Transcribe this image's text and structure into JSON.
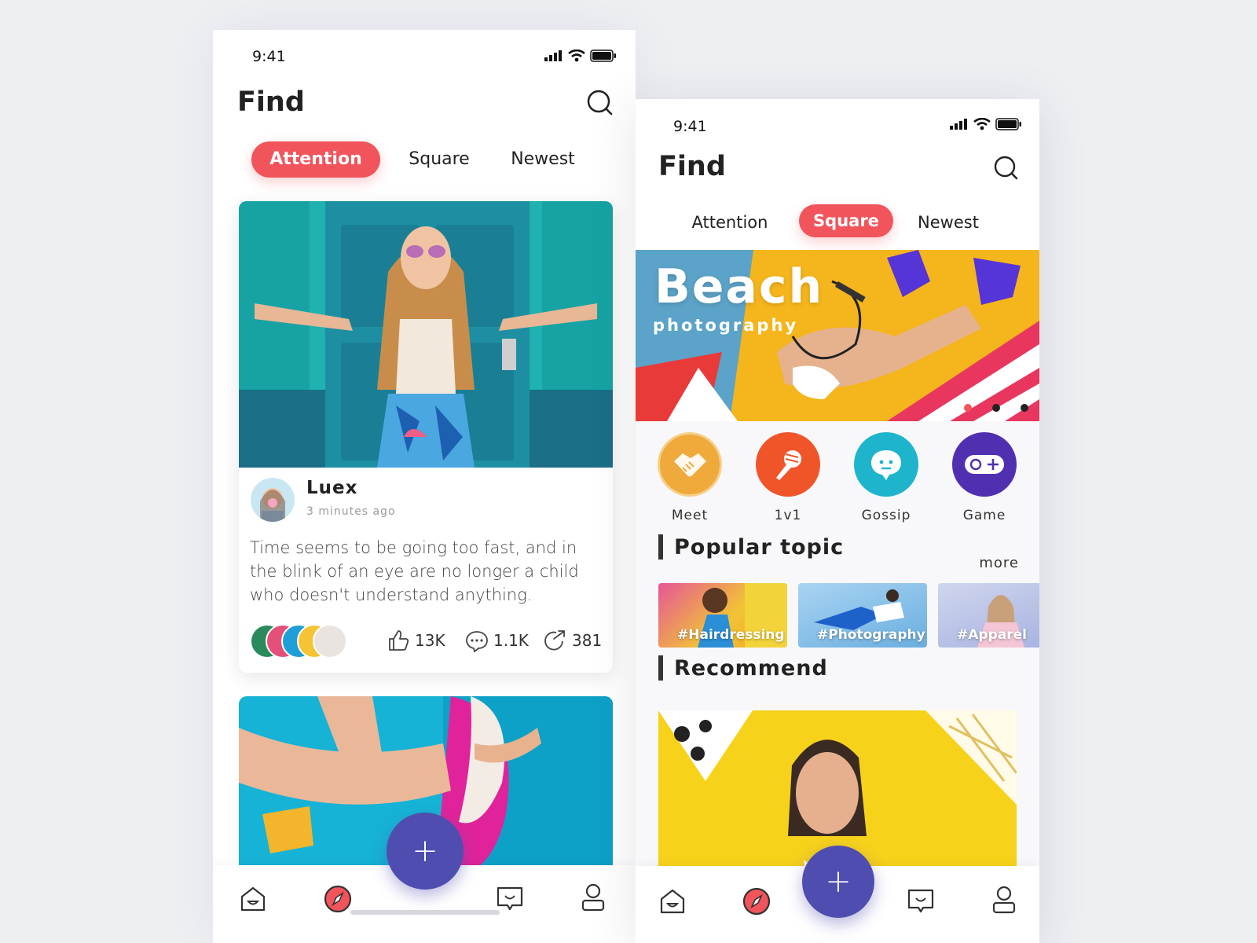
{
  "left_screen": {
    "status": {
      "time": "9:41"
    },
    "title": "Find",
    "tabs": [
      {
        "label": "Attention",
        "active": true
      },
      {
        "label": "Square",
        "active": false
      },
      {
        "label": "Newest",
        "active": false
      }
    ],
    "post": {
      "user": "Luex",
      "time_ago": "3 minutes ago",
      "text": "Time seems to be going too fast, and in the blink of an eye are no longer a child who doesn't understand anything.",
      "likes": "13K",
      "comments": "1.1K",
      "shares": "381"
    },
    "tabbar": [
      "home-icon",
      "discover-icon",
      "add-button",
      "messages-icon",
      "profile-icon"
    ]
  },
  "right_screen": {
    "status": {
      "time": "9:41"
    },
    "title": "Find",
    "tabs": [
      {
        "label": "Attention",
        "active": false
      },
      {
        "label": "Square",
        "active": true
      },
      {
        "label": "Newest",
        "active": false
      }
    ],
    "banner": {
      "title": "Beach",
      "subtitle": "photography",
      "slides": 3,
      "active_slide": 1
    },
    "categories": [
      {
        "label": "Meet",
        "color": "#f0a93b",
        "icon": "handshake-icon"
      },
      {
        "label": "1v1",
        "color": "#f0552a",
        "icon": "microphone-icon"
      },
      {
        "label": "Gossip",
        "color": "#1eb5cc",
        "icon": "chat-bubble-icon"
      },
      {
        "label": "Game",
        "color": "#5030b0",
        "icon": "gamepad-icon"
      }
    ],
    "popular": {
      "heading": "Popular topic",
      "more": "more",
      "topics": [
        "#Hairdressing",
        "#Photography",
        "#Apparel"
      ]
    },
    "recommend": {
      "heading": "Recommend"
    }
  },
  "colors": {
    "accent": "#f2545b",
    "fab": "#4f4eb0",
    "text": "#222222"
  }
}
